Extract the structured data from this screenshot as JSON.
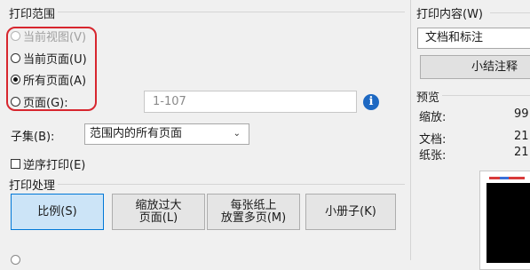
{
  "print_range": {
    "title": "打印范围",
    "options": [
      {
        "label": "当前视图(V)",
        "checked": false,
        "disabled": true
      },
      {
        "label": "当前页面(U)",
        "checked": false,
        "disabled": false
      },
      {
        "label": "所有页面(A)",
        "checked": true,
        "disabled": false
      },
      {
        "label": "页面(G):",
        "checked": false,
        "disabled": false
      }
    ],
    "pages_value": "1-107",
    "info_icon": "info-icon",
    "subset_label": "子集(B):",
    "subset_value": "范围内的所有页面",
    "reverse_label": "逆序打印(E)",
    "reverse_checked": false
  },
  "print_handling": {
    "title": "打印处理",
    "buttons": [
      {
        "line1": "比例(S)",
        "line2": "",
        "active": true
      },
      {
        "line1": "缩放过大",
        "line2": "页面(L)",
        "active": false
      },
      {
        "line1": "每张纸上",
        "line2": "放置多页(M)",
        "active": false
      },
      {
        "line1": "小册子(K)",
        "line2": "",
        "active": false
      }
    ]
  },
  "print_content": {
    "title": "打印内容(W)",
    "value": "文档和标注",
    "summarize_button": "小结注释"
  },
  "preview": {
    "title": "预览",
    "rows": [
      {
        "label": "缩放:",
        "value": "99"
      },
      {
        "label": "文档:",
        "value": "21"
      },
      {
        "label": "纸张:",
        "value": "21"
      }
    ]
  },
  "colors": {
    "highlight": "#d7262e",
    "accent": "#0078d7",
    "info": "#1d68c2"
  }
}
